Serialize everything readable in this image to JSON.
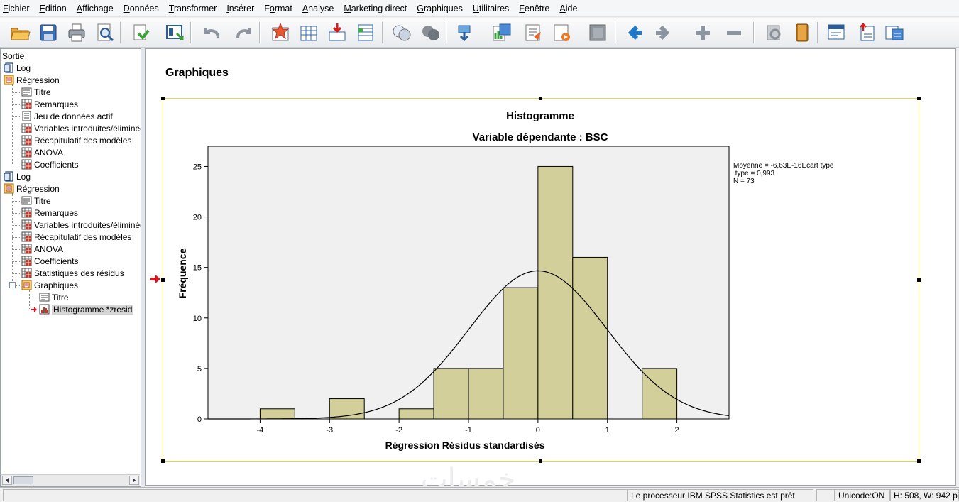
{
  "menu": [
    {
      "pre": "",
      "u": "F",
      "post": "ichier"
    },
    {
      "pre": "",
      "u": "E",
      "post": "dition"
    },
    {
      "pre": "",
      "u": "A",
      "post": "ffichage"
    },
    {
      "pre": "",
      "u": "D",
      "post": "onnées"
    },
    {
      "pre": "",
      "u": "T",
      "post": "ransformer"
    },
    {
      "pre": "",
      "u": "I",
      "post": "nsérer"
    },
    {
      "pre": "F",
      "u": "o",
      "post": "rmat"
    },
    {
      "pre": "",
      "u": "A",
      "post": "nalyse"
    },
    {
      "pre": "",
      "u": "M",
      "post": "arketing direct"
    },
    {
      "pre": "",
      "u": "G",
      "post": "raphiques"
    },
    {
      "pre": "",
      "u": "U",
      "post": "tilitaires"
    },
    {
      "pre": "",
      "u": "F",
      "post": "enêtre"
    },
    {
      "pre": "",
      "u": "A",
      "post": "ide"
    }
  ],
  "toolbar_icons": [
    "open-icon",
    "save-icon",
    "print-icon",
    "print-preview-icon",
    "export-icon",
    "recall-dialog-icon",
    "undo-icon",
    "redo-icon",
    "goto-data-icon",
    "goto-case-icon",
    "goto-variable-icon",
    "variables-icon",
    "show-all-icon",
    "hide-icon",
    "select-last-output-icon",
    "designate-window-icon",
    "run-script-icon",
    "edit-icon",
    "script-icon",
    "pivot-icon",
    "back-icon",
    "forward-icon",
    "expand-icon",
    "collapse-icon",
    "show-icon",
    "hide-item-icon",
    "insert-heading-icon",
    "insert-title-icon",
    "insert-text-icon"
  ],
  "navigator": {
    "root": "Sortie",
    "items": [
      {
        "label": "Log",
        "level": 0,
        "icon": "log"
      },
      {
        "label": "Régression",
        "level": 0,
        "icon": "proc"
      },
      {
        "label": "Titre",
        "level": 1,
        "icon": "title"
      },
      {
        "label": "Remarques",
        "level": 1,
        "icon": "table"
      },
      {
        "label": "Jeu de données actif",
        "level": 1,
        "icon": "doc"
      },
      {
        "label": "Variables introduites/éliminées",
        "level": 1,
        "icon": "table"
      },
      {
        "label": "Récapitulatif des modèles",
        "level": 1,
        "icon": "table"
      },
      {
        "label": "ANOVA",
        "level": 1,
        "icon": "table"
      },
      {
        "label": "Coefficients",
        "level": 1,
        "icon": "table"
      },
      {
        "label": "Log",
        "level": 0,
        "icon": "log"
      },
      {
        "label": "Régression",
        "level": 0,
        "icon": "proc"
      },
      {
        "label": "Titre",
        "level": 1,
        "icon": "title"
      },
      {
        "label": "Remarques",
        "level": 1,
        "icon": "table"
      },
      {
        "label": "Variables introduites/éliminées",
        "level": 1,
        "icon": "table"
      },
      {
        "label": "Récapitulatif des modèles",
        "level": 1,
        "icon": "table"
      },
      {
        "label": "ANOVA",
        "level": 1,
        "icon": "table"
      },
      {
        "label": "Coefficients",
        "level": 1,
        "icon": "table"
      },
      {
        "label": "Statistiques des résidus",
        "level": 1,
        "icon": "table"
      },
      {
        "label": "Graphiques",
        "level": 1,
        "icon": "proc"
      },
      {
        "label": "Titre",
        "level": 2,
        "icon": "title"
      },
      {
        "label": "Histogramme *zresid",
        "level": 2,
        "icon": "chart",
        "selected": true
      }
    ]
  },
  "content": {
    "heading": "Graphiques"
  },
  "chart_data": {
    "type": "bar",
    "subtype": "histogram",
    "title": "Histogramme",
    "subtitle": "Variable dépendante : BSC",
    "xlabel": "Régression Résidus standardisés",
    "ylabel": "Fréquence",
    "x_ticks": [
      -4,
      -3,
      -2,
      -1,
      0,
      1,
      2
    ],
    "y_ticks": [
      0,
      5,
      10,
      15,
      20,
      25
    ],
    "xlim": [
      -4.75,
      2.75
    ],
    "ylim": [
      0,
      27
    ],
    "bin_width": 0.5,
    "bins": [
      {
        "start": -4.0,
        "end": -3.5,
        "count": 1
      },
      {
        "start": -3.0,
        "end": -2.5,
        "count": 2
      },
      {
        "start": -2.0,
        "end": -1.5,
        "count": 1
      },
      {
        "start": -1.5,
        "end": -1.0,
        "count": 5
      },
      {
        "start": -1.0,
        "end": -0.5,
        "count": 5
      },
      {
        "start": -0.5,
        "end": 0.0,
        "count": 13
      },
      {
        "start": 0.0,
        "end": 0.5,
        "count": 25
      },
      {
        "start": 0.5,
        "end": 1.0,
        "count": 16
      },
      {
        "start": 1.5,
        "end": 2.0,
        "count": 5
      }
    ],
    "normal_curve": {
      "mean": 0,
      "sd": 0.993,
      "n": 73
    },
    "stats_box": [
      "Moyenne = -6,63E-16Ecart type",
      " type = 0,993",
      "N = 73"
    ],
    "bar_color": "#d3cf9b",
    "plot_bg": "#f0f0f0"
  },
  "statusbar": {
    "message": "Le processeur IBM SPSS Statistics  est prêt",
    "unicode": "Unicode:ON",
    "dims": "H: 508, W: 942 pt"
  },
  "watermark": "خمسات"
}
